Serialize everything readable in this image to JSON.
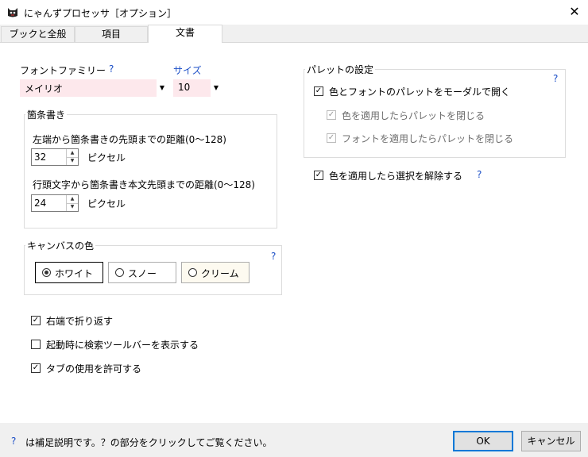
{
  "window": {
    "title": "にゃんずプロセッサ［オプション］"
  },
  "tabs": [
    {
      "label": "ブックと全般"
    },
    {
      "label": "項目"
    },
    {
      "label": "文書"
    }
  ],
  "font": {
    "family_label": "フォントファミリー",
    "help": "?",
    "family_value": "メイリオ",
    "size_label": "サイズ",
    "size_value": "10"
  },
  "bullets": {
    "title": "箇条書き",
    "left_label": "左端から箇条書きの先頭までの距離(0〜128)",
    "left_value": "32",
    "left_unit": "ピクセル",
    "body_label": "行頭文字から箇条書き本文先頭までの距離(0〜128)",
    "body_value": "24",
    "body_unit": "ピクセル"
  },
  "canvas": {
    "title": "キャンバスの色",
    "help": "?",
    "options": [
      "ホワイト",
      "スノー",
      "クリーム"
    ]
  },
  "options": {
    "wrap": "右端で折り返す",
    "search_bar": "起動時に検索ツールバーを表示する",
    "allow_tab": "タブの使用を許可する"
  },
  "palette": {
    "title": "パレットの設定",
    "help": "?",
    "modal": "色とフォントのパレットをモーダルで開く",
    "close_on_color": "色を適用したらパレットを閉じる",
    "close_on_font": "フォントを適用したらパレットを閉じる"
  },
  "deselect": {
    "label": "色を適用したら選択を解除する",
    "help": "?"
  },
  "footer": {
    "help_mark": "?",
    "note": "は補足説明です。？の部分をクリックしてご覧ください。",
    "ok": "OK",
    "cancel": "キャンセル"
  },
  "check_mark": "✓",
  "colors": {
    "accent": "#0078d7",
    "help_blue": "#1c4fc7",
    "combo_bg": "#fde8ec"
  }
}
